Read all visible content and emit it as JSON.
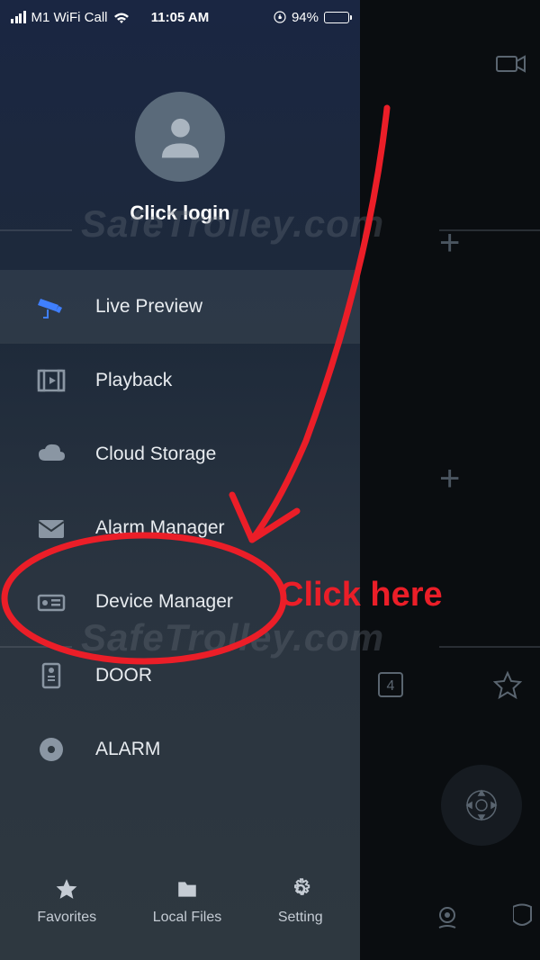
{
  "status_bar": {
    "carrier": "M1 WiFi Call",
    "time": "11:05 AM",
    "battery_pct": "94%"
  },
  "profile": {
    "login_cta": "Click login"
  },
  "menu": {
    "items": [
      {
        "label": "Live Preview",
        "selected": true
      },
      {
        "label": "Playback"
      },
      {
        "label": "Cloud Storage"
      },
      {
        "label": "Alarm Manager"
      },
      {
        "label": "Device Manager"
      },
      {
        "label": "DOOR"
      },
      {
        "label": "ALARM"
      }
    ]
  },
  "bottom": {
    "items": [
      {
        "label": "Favorites"
      },
      {
        "label": "Local Files"
      },
      {
        "label": "Setting"
      }
    ]
  },
  "watermark": "SafeTrolley.com",
  "annotation": {
    "label": "Click here"
  },
  "back_panel": {
    "stack_count": "4"
  }
}
